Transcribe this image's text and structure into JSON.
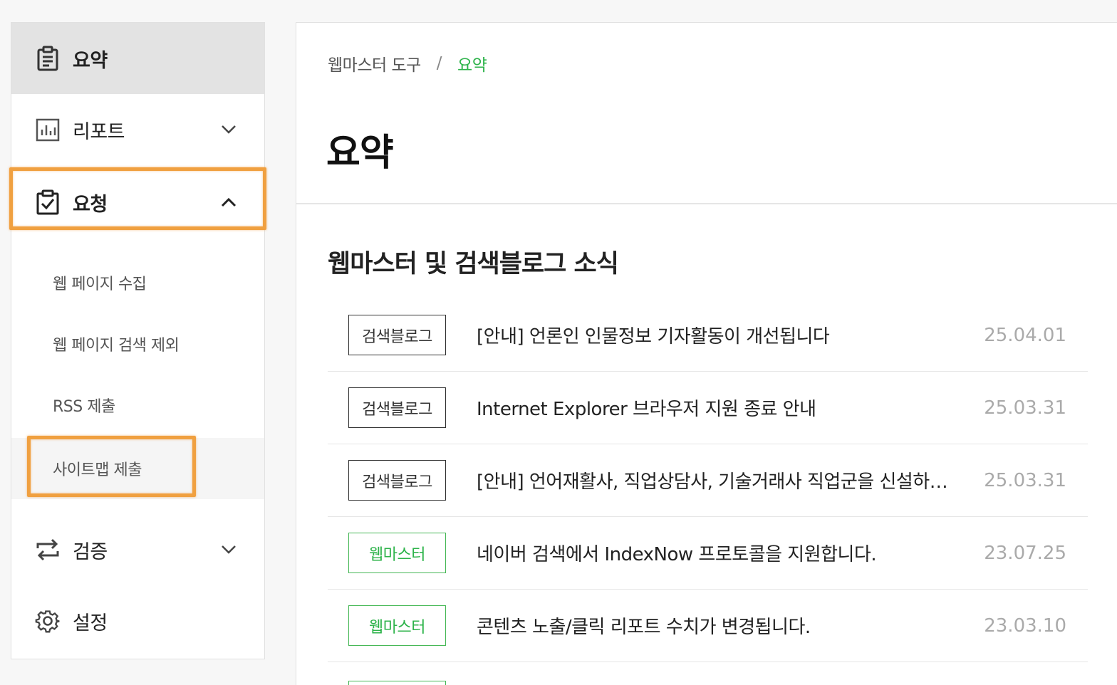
{
  "sidebar": {
    "items": [
      {
        "label": "요약",
        "icon": "clipboard-icon"
      },
      {
        "label": "리포트",
        "icon": "bar-chart-icon"
      },
      {
        "label": "요청",
        "icon": "clipboard-check-icon"
      },
      {
        "label": "검증",
        "icon": "sync-arrows-icon"
      },
      {
        "label": "설정",
        "icon": "gear-icon"
      }
    ],
    "sub_items": [
      {
        "label": "웹 페이지 수집"
      },
      {
        "label": "웹 페이지 검색 제외"
      },
      {
        "label": "RSS 제출"
      },
      {
        "label": "사이트맵 제출"
      }
    ]
  },
  "breadcrumb": {
    "root": "웹마스터 도구",
    "separator": "/",
    "current": "요약"
  },
  "page_title": "요약",
  "news": {
    "section_title": "웹마스터 및 검색블로그 소식",
    "items": [
      {
        "tag": "검색블로그",
        "title": "[안내] 언론인 인물정보 기자활동이 개선됩니다",
        "date": "25.04.01"
      },
      {
        "tag": "검색블로그",
        "title": "Internet Explorer 브라우저 지원 종료 안내",
        "date": "25.03.31"
      },
      {
        "tag": "검색블로그",
        "title": "[안내] 언어재활사, 직업상담사, 기술거래사 직업군을 신설하…",
        "date": "25.03.31"
      },
      {
        "tag": "웹마스터",
        "title": "네이버 검색에서 IndexNow 프로토콜을 지원합니다.",
        "date": "23.07.25"
      },
      {
        "tag": "웹마스터",
        "title": "콘텐츠 노출/클릭 리포트 수치가 변경됩니다.",
        "date": "23.03.10"
      }
    ]
  },
  "colors": {
    "accent_green": "#2db34a",
    "highlight_orange": "#f0a040",
    "active_bg": "#e3e3e3"
  }
}
